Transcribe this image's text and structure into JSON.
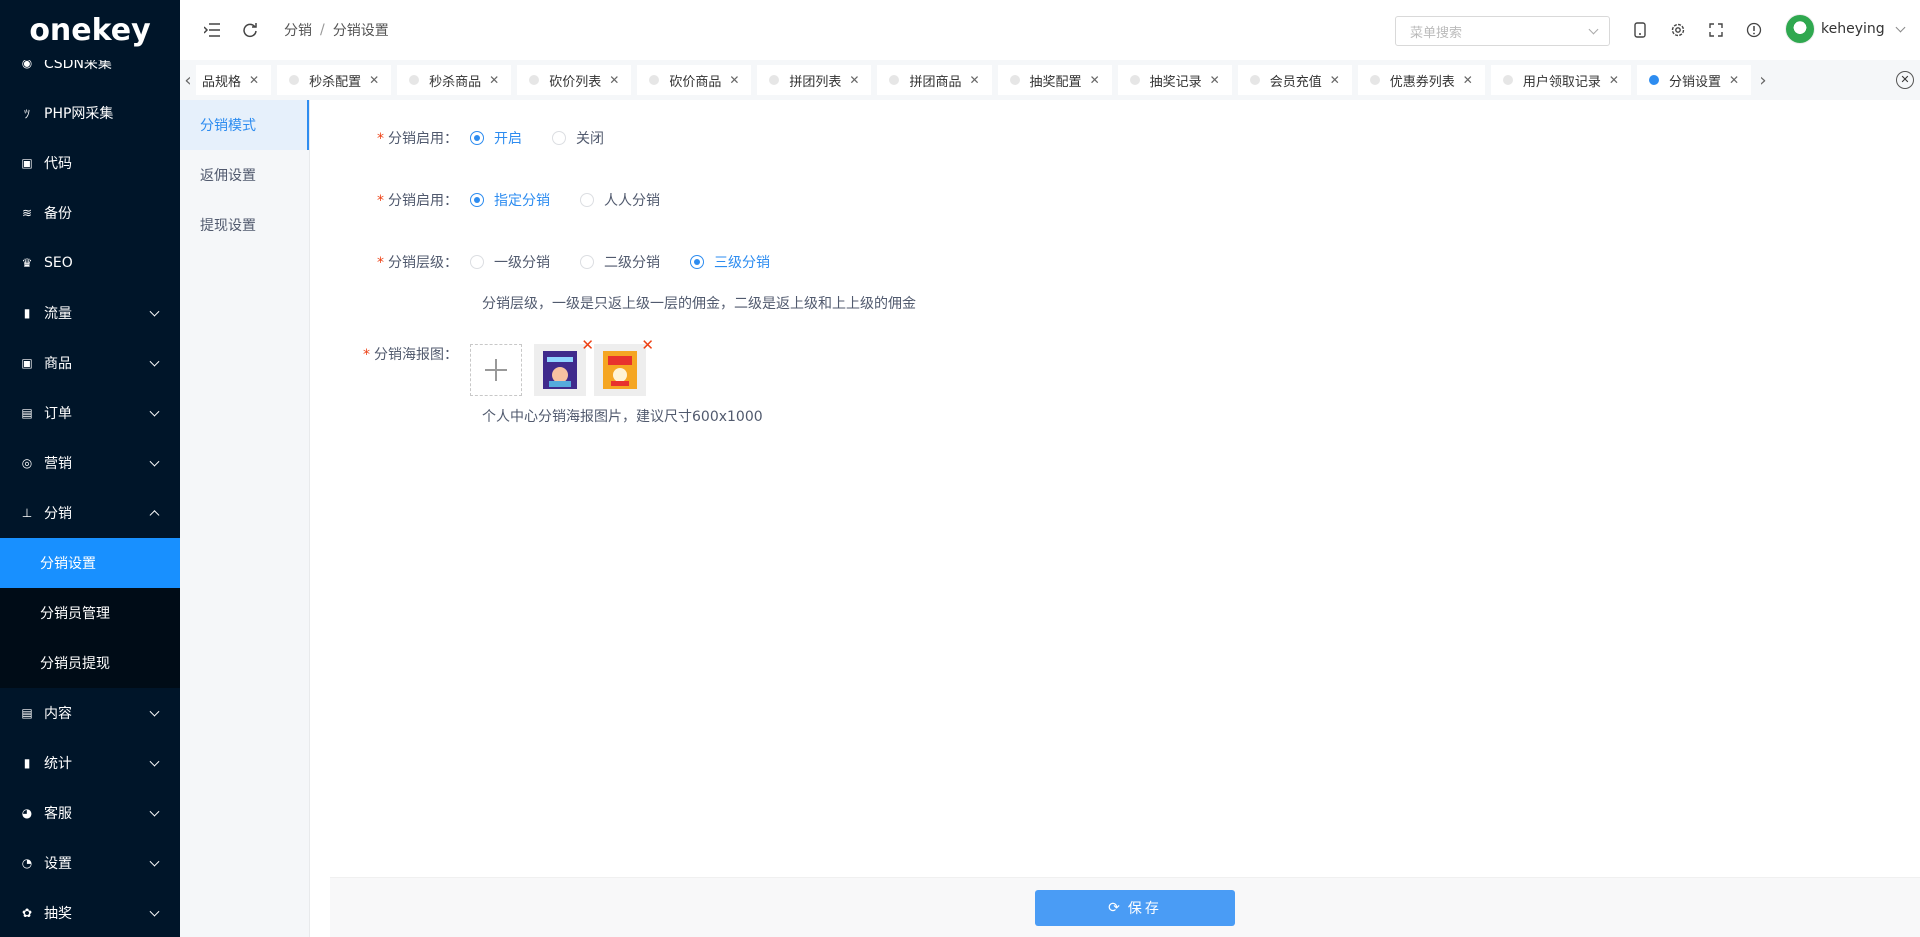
{
  "brand": {
    "logo_text": "onekey"
  },
  "sidebar": {
    "items": [
      {
        "label": "CSDN采集",
        "icon": "circle-c-icon",
        "glyph": "◉"
      },
      {
        "label": "PHP网采集",
        "icon": "spider-icon",
        "glyph": "ﾂ"
      },
      {
        "label": "代码",
        "icon": "code-icon",
        "glyph": "▣"
      },
      {
        "label": "备份",
        "icon": "database-icon",
        "glyph": "≋"
      },
      {
        "label": "SEO",
        "icon": "trophy-icon",
        "glyph": "♛"
      },
      {
        "label": "流量",
        "icon": "bar-chart-icon",
        "glyph": "▮"
      },
      {
        "label": "商品",
        "icon": "bag-icon",
        "glyph": "▣"
      },
      {
        "label": "订单",
        "icon": "order-icon",
        "glyph": "▤"
      },
      {
        "label": "营销",
        "icon": "alarm-icon",
        "glyph": "◎"
      },
      {
        "label": "分销",
        "icon": "sitemap-icon",
        "glyph": "⊥"
      }
    ],
    "distribution_sub": [
      {
        "label": "分销设置",
        "active": true
      },
      {
        "label": "分销员管理",
        "active": false
      },
      {
        "label": "分销员提现",
        "active": false
      }
    ],
    "items_after": [
      {
        "label": "内容",
        "icon": "document-icon",
        "glyph": "▤"
      },
      {
        "label": "统计",
        "icon": "bar-chart-icon",
        "glyph": "▮"
      },
      {
        "label": "客服",
        "icon": "service-icon",
        "glyph": "◕"
      },
      {
        "label": "设置",
        "icon": "settings-icon",
        "glyph": "◔"
      },
      {
        "label": "抽奖",
        "icon": "gift-icon",
        "glyph": "✿"
      }
    ]
  },
  "header": {
    "breadcrumb": [
      "分销",
      "分销设置"
    ],
    "search_placeholder": "菜单搜索",
    "username": "keheying"
  },
  "tabs": [
    {
      "label": "品规格",
      "active": false,
      "first": true
    },
    {
      "label": "秒杀配置",
      "active": false
    },
    {
      "label": "秒杀商品",
      "active": false
    },
    {
      "label": "砍价列表",
      "active": false
    },
    {
      "label": "砍价商品",
      "active": false
    },
    {
      "label": "拼团列表",
      "active": false
    },
    {
      "label": "拼团商品",
      "active": false
    },
    {
      "label": "抽奖配置",
      "active": false
    },
    {
      "label": "抽奖记录",
      "active": false
    },
    {
      "label": "会员充值",
      "active": false
    },
    {
      "label": "优惠券列表",
      "active": false
    },
    {
      "label": "用户领取记录",
      "active": false
    },
    {
      "label": "分销设置",
      "active": true
    }
  ],
  "subnav": [
    {
      "label": "分销模式",
      "active": true
    },
    {
      "label": "返佣设置",
      "active": false
    },
    {
      "label": "提现设置",
      "active": false
    }
  ],
  "form": {
    "enable": {
      "label": "分销启用：",
      "options": [
        "开启",
        "关闭"
      ],
      "selected": 0
    },
    "mode": {
      "label": "分销启用：",
      "options": [
        "指定分销",
        "人人分销"
      ],
      "selected": 0
    },
    "level": {
      "label": "分销层级：",
      "options": [
        "一级分销",
        "二级分销",
        "三级分销"
      ],
      "selected": 2,
      "tip": "分销层级，一级是只返上级一层的佣金，二级是返上级和上上级的佣金"
    },
    "poster": {
      "label": "分销海报图：",
      "tip": "个人中心分销海报图片，建议尺寸600x1000"
    }
  },
  "footer": {
    "save_label": "保存"
  },
  "colors": {
    "primary": "#2d8cf0",
    "sidebar_bg": "#001529",
    "active_menu": "#1890ff"
  }
}
